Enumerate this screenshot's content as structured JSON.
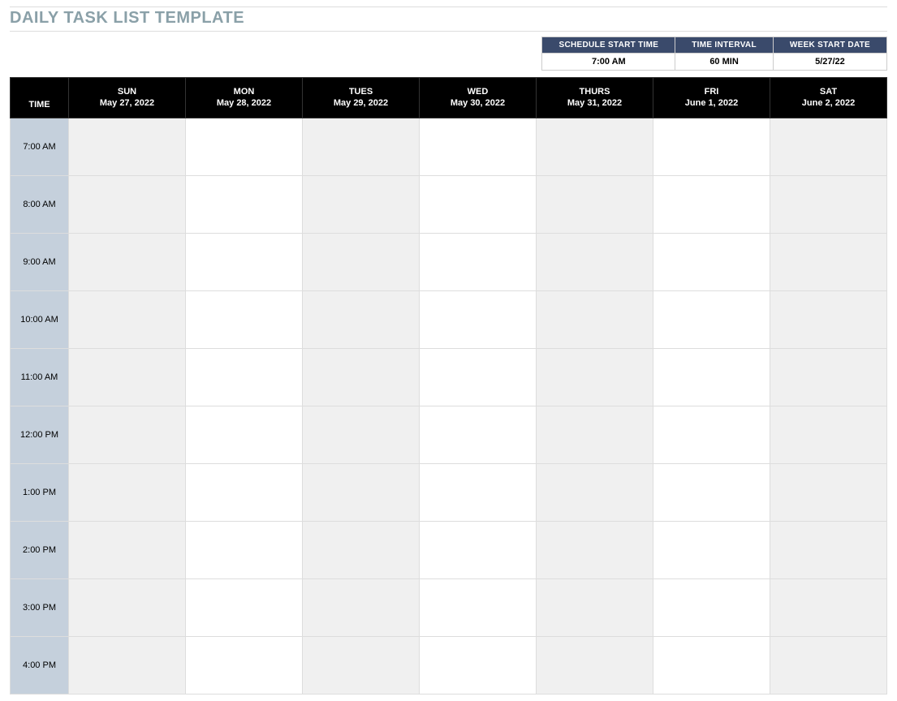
{
  "title": "DAILY TASK LIST TEMPLATE",
  "settings": {
    "headers": {
      "start_time": "SCHEDULE START TIME",
      "interval": "TIME INTERVAL",
      "week_start": "WEEK START DATE"
    },
    "values": {
      "start_time": "7:00 AM",
      "interval": "60 MIN",
      "week_start": "5/27/22"
    }
  },
  "schedule": {
    "time_header": "TIME",
    "days": [
      {
        "name": "SUN",
        "date": "May 27, 2022"
      },
      {
        "name": "MON",
        "date": "May 28, 2022"
      },
      {
        "name": "TUES",
        "date": "May 29, 2022"
      },
      {
        "name": "WED",
        "date": "May 30, 2022"
      },
      {
        "name": "THURS",
        "date": "May 31, 2022"
      },
      {
        "name": "FRI",
        "date": "June 1, 2022"
      },
      {
        "name": "SAT",
        "date": "June 2, 2022"
      }
    ],
    "time_slots": [
      "7:00 AM",
      "8:00 AM",
      "9:00 AM",
      "10:00 AM",
      "11:00 AM",
      "12:00 PM",
      "1:00 PM",
      "2:00 PM",
      "3:00 PM",
      "4:00 PM"
    ]
  }
}
